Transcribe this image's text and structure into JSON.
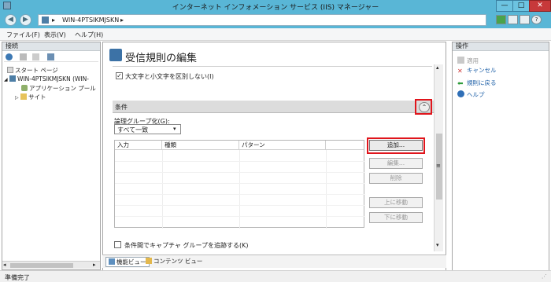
{
  "window": {
    "title": "インターネット インフォメーション サービス (IIS) マネージャー",
    "min": "—",
    "max": "□",
    "close": "✕"
  },
  "address": {
    "path": "WIN-4PTSIKMJSKN",
    "sep": "▸"
  },
  "menu": [
    "ファイル(F)",
    "表示(V)",
    "ヘルプ(H)"
  ],
  "left_pane": {
    "header": "接続",
    "tree": [
      {
        "label": "スタート ページ"
      },
      {
        "label": "WIN-4PTSIKMJSKN (WIN-"
      },
      {
        "label": "アプリケーション プール"
      },
      {
        "label": "サイト"
      }
    ]
  },
  "center": {
    "title": "受信規則の編集",
    "ignore_case_label": "大文字と小文字を区別しない(I)",
    "conditions_header": "条件",
    "logical_grouping_label": "論理グループ化(G):",
    "logical_grouping_value": "すべて一致",
    "table_headers": [
      "入力",
      "種類",
      "パターン"
    ],
    "buttons": {
      "add": "追加...",
      "edit": "編集...",
      "remove": "削除",
      "move_up": "上に移動",
      "move_down": "下に移動"
    },
    "track_groups_label": "条件間でキャプチャ グループを追跡する(K)"
  },
  "view_tabs": [
    "機能ビュー",
    "コンテンツ ビュー"
  ],
  "right_pane": {
    "header": "操作",
    "actions": [
      "適用",
      "キャンセル",
      "規則に戻る",
      "ヘルプ"
    ]
  },
  "status": "準備完了",
  "colors": {
    "titlebar": "#59b6d6",
    "highlight": "#e0151c",
    "group_header": "#dcdcdc"
  }
}
